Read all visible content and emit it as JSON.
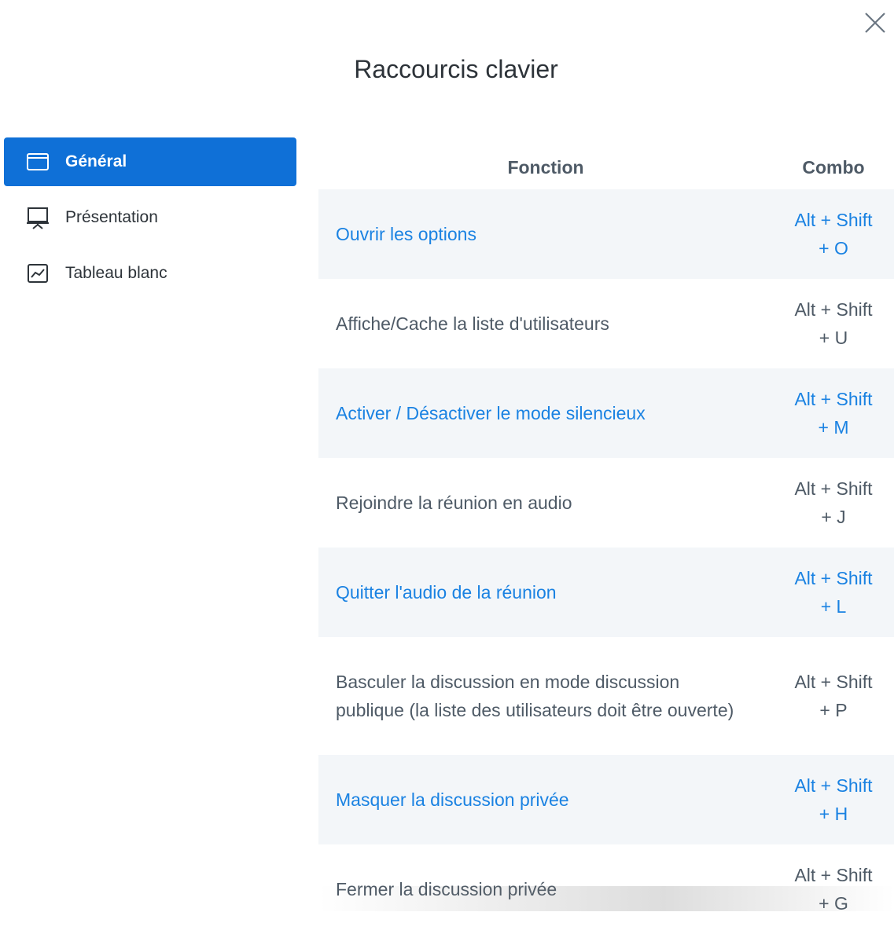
{
  "modal": {
    "title": "Raccourcis clavier",
    "close_icon": "close-icon"
  },
  "sidebar": {
    "items": [
      {
        "label": "Général",
        "icon": "browser-window-icon",
        "active": true
      },
      {
        "label": "Présentation",
        "icon": "presentation-board-icon",
        "active": false
      },
      {
        "label": "Tableau blanc",
        "icon": "whiteboard-chart-icon",
        "active": false
      }
    ]
  },
  "table": {
    "headers": {
      "function": "Fonction",
      "combo": "Combo"
    },
    "rows": [
      {
        "function": "Ouvrir les options",
        "combo_1": "Alt + Shift",
        "combo_2": "+ O"
      },
      {
        "function": "Affiche/Cache la liste d'utilisateurs",
        "combo_1": "Alt + Shift",
        "combo_2": "+ U"
      },
      {
        "function": "Activer / Désactiver le mode silencieux",
        "combo_1": "Alt + Shift",
        "combo_2": "+ M"
      },
      {
        "function": "Rejoindre la réunion en audio",
        "combo_1": "Alt + Shift",
        "combo_2": "+ J"
      },
      {
        "function": "Quitter l'audio de la réunion",
        "combo_1": "Alt + Shift",
        "combo_2": "+ L"
      },
      {
        "function": "Basculer la discussion en mode discussion publique (la liste des utilisateurs doit être ouverte)",
        "combo_1": "Alt + Shift",
        "combo_2": "+ P"
      },
      {
        "function": "Masquer la discussion privée",
        "combo_1": "Alt + Shift",
        "combo_2": "+ H"
      },
      {
        "function": "Fermer la discussion privée",
        "combo_1": "Alt + Shift",
        "combo_2": "+ G"
      }
    ]
  },
  "colors": {
    "accent": "#0f70d7",
    "link_text": "#1a82e2",
    "row_alt_bg": "#f3f6f9",
    "text": "#4e5a66"
  }
}
